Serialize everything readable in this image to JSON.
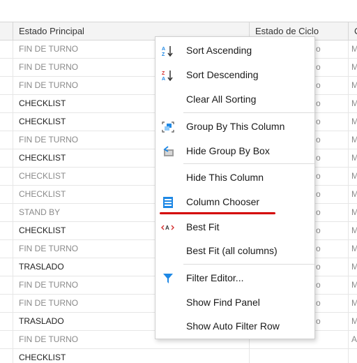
{
  "grid": {
    "columns": [
      "",
      "Estado Principal",
      "Estado de Ciclo",
      "C"
    ],
    "rows": [
      {
        "estado": "FIN DE TURNO",
        "ciclo": "o",
        "extra": "M",
        "style": "muted"
      },
      {
        "estado": "FIN DE TURNO",
        "ciclo": "o",
        "extra": "M",
        "style": "muted"
      },
      {
        "estado": "FIN DE TURNO",
        "ciclo": "o",
        "extra": "M",
        "style": "muted"
      },
      {
        "estado": "CHECKLIST",
        "ciclo": "o",
        "extra": "M",
        "style": "strong"
      },
      {
        "estado": "CHECKLIST",
        "ciclo": "o",
        "extra": "M",
        "style": "strong"
      },
      {
        "estado": "FIN DE TURNO",
        "ciclo": "o",
        "extra": "M",
        "style": "muted"
      },
      {
        "estado": "CHECKLIST",
        "ciclo": "o",
        "extra": "M",
        "style": "strong"
      },
      {
        "estado": "CHECKLIST",
        "ciclo": "o",
        "extra": "M",
        "style": "muted"
      },
      {
        "estado": "CHECKLIST",
        "ciclo": "o",
        "extra": "M",
        "style": "muted"
      },
      {
        "estado": "STAND BY",
        "ciclo": "o",
        "extra": "M",
        "style": "muted"
      },
      {
        "estado": "CHECKLIST",
        "ciclo": "o",
        "extra": "M",
        "style": "strong"
      },
      {
        "estado": "FIN DE TURNO",
        "ciclo": "o",
        "extra": "M",
        "style": "muted"
      },
      {
        "estado": "TRASLADO",
        "ciclo": "o",
        "extra": "M",
        "style": "strong"
      },
      {
        "estado": "FIN DE TURNO",
        "ciclo": "o",
        "extra": "M",
        "style": "muted"
      },
      {
        "estado": "FIN DE TURNO",
        "ciclo": "o",
        "extra": "M",
        "style": "muted"
      },
      {
        "estado": "TRASLADO",
        "ciclo": "o",
        "extra": "M",
        "style": "strong"
      },
      {
        "estado": "FIN DE TURNO",
        "ciclo": "",
        "extra": "A",
        "style": "muted"
      },
      {
        "estado": "CHECKLIST",
        "ciclo": "",
        "extra": "",
        "style": "strong"
      }
    ]
  },
  "menu": {
    "items": [
      {
        "label": "Sort Ascending",
        "icon": "sort-ascending-icon"
      },
      {
        "label": "Sort Descending",
        "icon": "sort-descending-icon"
      },
      {
        "label": "Clear All Sorting",
        "icon": ""
      },
      {
        "label": "Group By This Column",
        "icon": "group-by-column-icon"
      },
      {
        "label": "Hide Group By Box",
        "icon": "hide-group-box-icon"
      },
      {
        "label": "Hide This Column",
        "icon": ""
      },
      {
        "label": "Column Chooser",
        "icon": "column-chooser-icon"
      },
      {
        "label": "Best Fit",
        "icon": "best-fit-icon"
      },
      {
        "label": "Best Fit (all columns)",
        "icon": ""
      },
      {
        "label": "Filter Editor...",
        "icon": "filter-icon"
      },
      {
        "label": "Show Find Panel",
        "icon": ""
      },
      {
        "label": "Show Auto Filter Row",
        "icon": ""
      }
    ]
  },
  "colors": {
    "accent": "#1e88e5",
    "highlight": "#d40000"
  }
}
